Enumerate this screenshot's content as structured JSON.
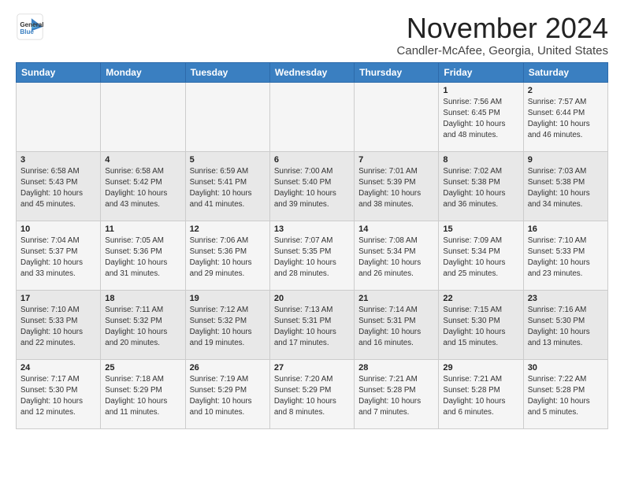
{
  "logo": {
    "line1": "General",
    "line2": "Blue"
  },
  "title": "November 2024",
  "location": "Candler-McAfee, Georgia, United States",
  "days_of_week": [
    "Sunday",
    "Monday",
    "Tuesday",
    "Wednesday",
    "Thursday",
    "Friday",
    "Saturday"
  ],
  "weeks": [
    [
      {
        "day": "",
        "info": ""
      },
      {
        "day": "",
        "info": ""
      },
      {
        "day": "",
        "info": ""
      },
      {
        "day": "",
        "info": ""
      },
      {
        "day": "",
        "info": ""
      },
      {
        "day": "1",
        "info": "Sunrise: 7:56 AM\nSunset: 6:45 PM\nDaylight: 10 hours\nand 48 minutes."
      },
      {
        "day": "2",
        "info": "Sunrise: 7:57 AM\nSunset: 6:44 PM\nDaylight: 10 hours\nand 46 minutes."
      }
    ],
    [
      {
        "day": "3",
        "info": "Sunrise: 6:58 AM\nSunset: 5:43 PM\nDaylight: 10 hours\nand 45 minutes."
      },
      {
        "day": "4",
        "info": "Sunrise: 6:58 AM\nSunset: 5:42 PM\nDaylight: 10 hours\nand 43 minutes."
      },
      {
        "day": "5",
        "info": "Sunrise: 6:59 AM\nSunset: 5:41 PM\nDaylight: 10 hours\nand 41 minutes."
      },
      {
        "day": "6",
        "info": "Sunrise: 7:00 AM\nSunset: 5:40 PM\nDaylight: 10 hours\nand 39 minutes."
      },
      {
        "day": "7",
        "info": "Sunrise: 7:01 AM\nSunset: 5:39 PM\nDaylight: 10 hours\nand 38 minutes."
      },
      {
        "day": "8",
        "info": "Sunrise: 7:02 AM\nSunset: 5:38 PM\nDaylight: 10 hours\nand 36 minutes."
      },
      {
        "day": "9",
        "info": "Sunrise: 7:03 AM\nSunset: 5:38 PM\nDaylight: 10 hours\nand 34 minutes."
      }
    ],
    [
      {
        "day": "10",
        "info": "Sunrise: 7:04 AM\nSunset: 5:37 PM\nDaylight: 10 hours\nand 33 minutes."
      },
      {
        "day": "11",
        "info": "Sunrise: 7:05 AM\nSunset: 5:36 PM\nDaylight: 10 hours\nand 31 minutes."
      },
      {
        "day": "12",
        "info": "Sunrise: 7:06 AM\nSunset: 5:36 PM\nDaylight: 10 hours\nand 29 minutes."
      },
      {
        "day": "13",
        "info": "Sunrise: 7:07 AM\nSunset: 5:35 PM\nDaylight: 10 hours\nand 28 minutes."
      },
      {
        "day": "14",
        "info": "Sunrise: 7:08 AM\nSunset: 5:34 PM\nDaylight: 10 hours\nand 26 minutes."
      },
      {
        "day": "15",
        "info": "Sunrise: 7:09 AM\nSunset: 5:34 PM\nDaylight: 10 hours\nand 25 minutes."
      },
      {
        "day": "16",
        "info": "Sunrise: 7:10 AM\nSunset: 5:33 PM\nDaylight: 10 hours\nand 23 minutes."
      }
    ],
    [
      {
        "day": "17",
        "info": "Sunrise: 7:10 AM\nSunset: 5:33 PM\nDaylight: 10 hours\nand 22 minutes."
      },
      {
        "day": "18",
        "info": "Sunrise: 7:11 AM\nSunset: 5:32 PM\nDaylight: 10 hours\nand 20 minutes."
      },
      {
        "day": "19",
        "info": "Sunrise: 7:12 AM\nSunset: 5:32 PM\nDaylight: 10 hours\nand 19 minutes."
      },
      {
        "day": "20",
        "info": "Sunrise: 7:13 AM\nSunset: 5:31 PM\nDaylight: 10 hours\nand 17 minutes."
      },
      {
        "day": "21",
        "info": "Sunrise: 7:14 AM\nSunset: 5:31 PM\nDaylight: 10 hours\nand 16 minutes."
      },
      {
        "day": "22",
        "info": "Sunrise: 7:15 AM\nSunset: 5:30 PM\nDaylight: 10 hours\nand 15 minutes."
      },
      {
        "day": "23",
        "info": "Sunrise: 7:16 AM\nSunset: 5:30 PM\nDaylight: 10 hours\nand 13 minutes."
      }
    ],
    [
      {
        "day": "24",
        "info": "Sunrise: 7:17 AM\nSunset: 5:30 PM\nDaylight: 10 hours\nand 12 minutes."
      },
      {
        "day": "25",
        "info": "Sunrise: 7:18 AM\nSunset: 5:29 PM\nDaylight: 10 hours\nand 11 minutes."
      },
      {
        "day": "26",
        "info": "Sunrise: 7:19 AM\nSunset: 5:29 PM\nDaylight: 10 hours\nand 10 minutes."
      },
      {
        "day": "27",
        "info": "Sunrise: 7:20 AM\nSunset: 5:29 PM\nDaylight: 10 hours\nand 8 minutes."
      },
      {
        "day": "28",
        "info": "Sunrise: 7:21 AM\nSunset: 5:28 PM\nDaylight: 10 hours\nand 7 minutes."
      },
      {
        "day": "29",
        "info": "Sunrise: 7:21 AM\nSunset: 5:28 PM\nDaylight: 10 hours\nand 6 minutes."
      },
      {
        "day": "30",
        "info": "Sunrise: 7:22 AM\nSunset: 5:28 PM\nDaylight: 10 hours\nand 5 minutes."
      }
    ]
  ]
}
